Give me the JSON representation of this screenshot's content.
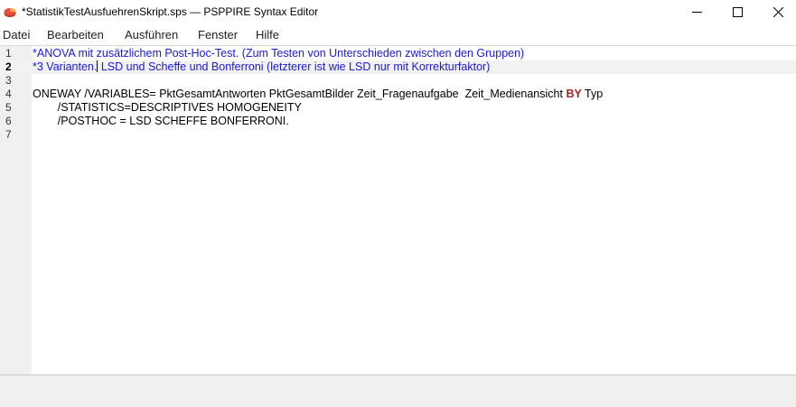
{
  "window": {
    "title": "*StatistikTestAusfuehrenSkript.sps — PSPPIRE Syntax Editor",
    "app_icon": "pspp-icon",
    "controls": [
      "minimize-icon",
      "maximize-icon",
      "close-icon"
    ]
  },
  "menu": {
    "items": [
      "Datei",
      "Bearbeiten",
      "Ausführen",
      "Fenster",
      "Hilfe"
    ]
  },
  "editor": {
    "current_line": 2,
    "line_numbers": [
      "1",
      "2",
      "3",
      "4",
      "5",
      "6",
      "7"
    ],
    "lines": {
      "l1": "*ANOVA mit zusätzlichem Post-Hoc-Test. (Zum Testen von Unterschieden zwischen den Gruppen)",
      "l2a": "*3 Varianten.",
      "l2b": " LSD und Scheffe und Bonferroni (letzterer ist wie LSD nur mit Korrekturfaktor)",
      "l3": "",
      "l4a": "ONEWAY /VARIABLES= PktGesamtAntworten PktGesamtBilder Zeit_Fragenaufgabe  Zeit_Medienansicht ",
      "l4kw": "BY",
      "l4b": " Typ",
      "l5": "        /STATISTICS=DESCRIPTIVES HOMOGENEITY",
      "l6": "        /POSTHOC = LSD SCHEFFE BONFERRONI.",
      "l7": ""
    },
    "colors": {
      "comment": "#1a1ad4",
      "keyword": "#a0262a",
      "gutter_bg": "#f0f0f0",
      "current_line_bg": "#f2f2f2"
    }
  }
}
